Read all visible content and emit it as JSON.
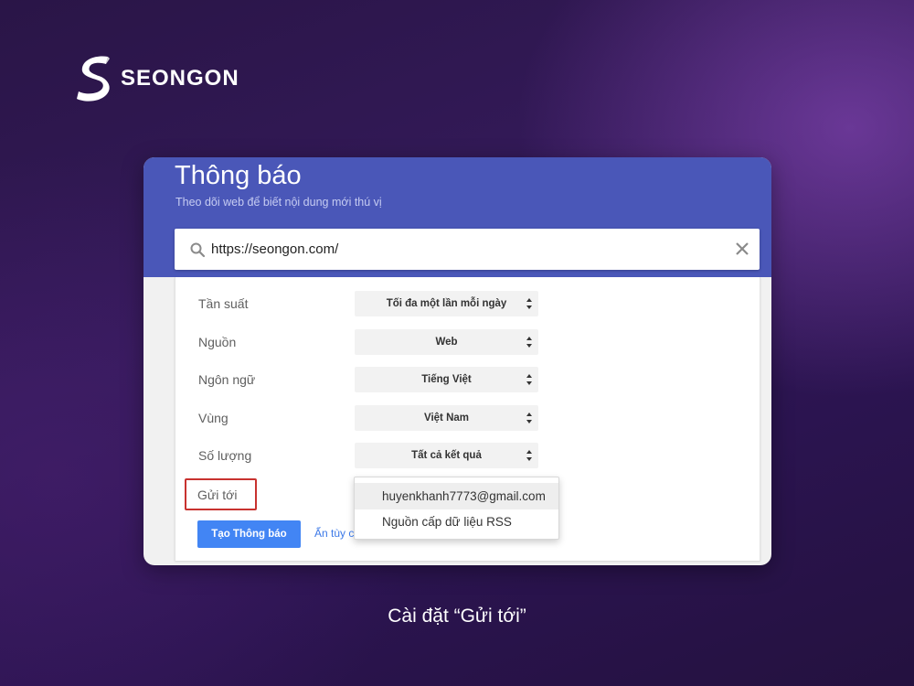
{
  "brand": {
    "name": "SEONGON"
  },
  "panel": {
    "title": "Thông báo",
    "subtitle": "Theo dõi web để biết nội dung mới thú vị",
    "search": {
      "value": "https://seongon.com/",
      "icon": "search-icon",
      "clear_icon": "close-icon"
    }
  },
  "options": [
    {
      "label": "Tần suất",
      "value": "Tối đa một lần mỗi ngày"
    },
    {
      "label": "Nguồn",
      "value": "Web"
    },
    {
      "label": "Ngôn ngữ",
      "value": "Tiếng Việt"
    },
    {
      "label": "Vùng",
      "value": "Việt Nam"
    },
    {
      "label": "Số lượng",
      "value": "Tất cả kết quả"
    }
  ],
  "send_to": {
    "label": "Gửi tới",
    "dropdown": [
      {
        "label": "huyenkhanh7773@gmail.com",
        "selected": true
      },
      {
        "label": "Nguồn cấp dữ liệu RSS",
        "selected": false
      }
    ]
  },
  "actions": {
    "create_label": "Tạo Thông báo",
    "hide_options_label": "Ẩn tùy c"
  },
  "caption": "Cài đặt “Gửi tới”",
  "colors": {
    "header": "#4a57b8",
    "primary_button": "#4285f4",
    "highlight_border": "#c8322f",
    "link": "#3b78e7"
  }
}
